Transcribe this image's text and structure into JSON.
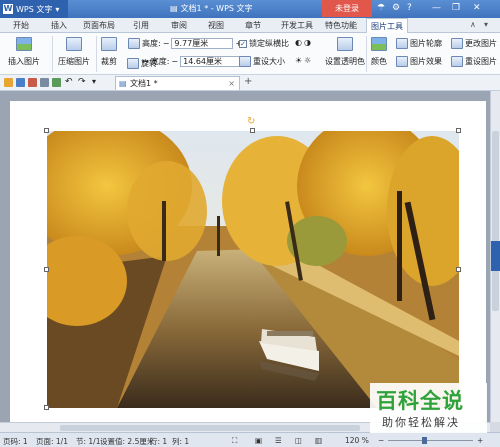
{
  "app": {
    "name": "WPS 文字",
    "doc_title": "文档1 * - WPS 文字",
    "login": "未登录"
  },
  "menu_tabs": [
    "开始",
    "插入",
    "页面布局",
    "引用",
    "审阅",
    "视图",
    "章节",
    "开发工具",
    "特色功能",
    "图片工具"
  ],
  "active_tab": "图片工具",
  "ribbon": {
    "insert_picture": "插入图片",
    "compress_picture": "压缩图片",
    "crop": "裁剪",
    "rotate": "旋转",
    "height_label": "高度:",
    "height_value": "9.77厘米",
    "width_label": "宽度:",
    "width_value": "14.64厘米",
    "lock_ratio": "锁定纵横比",
    "reset_size": "重设大小",
    "set_transparent": "设置透明色",
    "color": "颜色",
    "picture_outline": "图片轮廓",
    "picture_effect": "图片效果",
    "change_picture": "更改图片",
    "reset_picture": "重设图片"
  },
  "doc_tab": "文档1 *",
  "status": {
    "page": "页码: 1",
    "pages": "页面: 1/1",
    "section": "节: 1/1",
    "setting": "设置值: 2.5厘米",
    "row": "行: 1",
    "col": "列: 1",
    "zoom": "120 %"
  },
  "watermark": {
    "title": "百科全说",
    "subtitle": "助你轻松解决"
  },
  "colors": {
    "titlebar": "#4a7fc8",
    "login": "#e2574c",
    "watermark_green": "#2fa23c"
  }
}
